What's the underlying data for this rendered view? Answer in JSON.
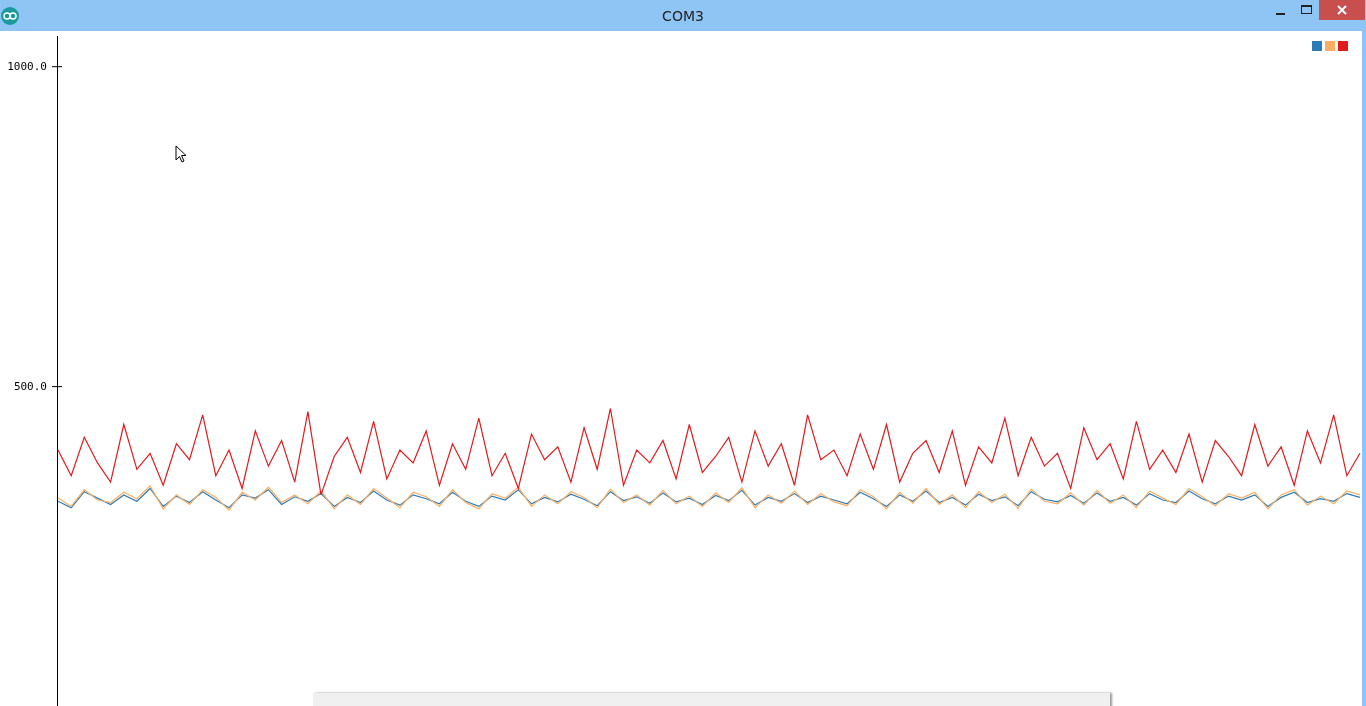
{
  "window": {
    "title": "COM3"
  },
  "plot": {
    "chart_data": {
      "type": "line",
      "ylim": [
        0,
        1055
      ],
      "yticks": [
        {
          "value": 1000,
          "label": "1000.0"
        },
        {
          "value": 500,
          "label": "500.0"
        }
      ],
      "series": [
        {
          "color": "#2b7bb9",
          "values": [
            320,
            310,
            335,
            325,
            315,
            330,
            320,
            340,
            312,
            328,
            318,
            335,
            322,
            310,
            330,
            325,
            338,
            315,
            327,
            320,
            332,
            312,
            326,
            318,
            336,
            322,
            314,
            330,
            324,
            316,
            334,
            320,
            312,
            328,
            322,
            338,
            316,
            326,
            319,
            331,
            323,
            313,
            335,
            321,
            327,
            317,
            333,
            319,
            325,
            315,
            329,
            321,
            337,
            314,
            326,
            320,
            332,
            318,
            328,
            322,
            316,
            334,
            324,
            312,
            330,
            320,
            336,
            318,
            326,
            314,
            331,
            321,
            327,
            313,
            335,
            323,
            319,
            329,
            317,
            333,
            320,
            326,
            314,
            332,
            322,
            318,
            336,
            324,
            316,
            328,
            322,
            330,
            312,
            326,
            334,
            318,
            324,
            320,
            332,
            326
          ]
        },
        {
          "color": "#fdae61",
          "values": [
            325,
            312,
            338,
            322,
            318,
            334,
            324,
            344,
            308,
            330,
            315,
            338,
            326,
            306,
            334,
            322,
            342,
            318,
            330,
            316,
            336,
            308,
            330,
            315,
            340,
            325,
            310,
            334,
            327,
            312,
            338,
            318,
            308,
            332,
            325,
            342,
            312,
            330,
            316,
            335,
            326,
            310,
            339,
            318,
            330,
            314,
            337,
            316,
            328,
            312,
            333,
            318,
            341,
            310,
            330,
            317,
            336,
            315,
            332,
            319,
            313,
            338,
            327,
            308,
            334,
            317,
            340,
            315,
            330,
            310,
            335,
            318,
            331,
            309,
            339,
            320,
            316,
            333,
            314,
            337,
            317,
            330,
            310,
            336,
            325,
            315,
            340,
            327,
            313,
            332,
            325,
            334,
            308,
            330,
            338,
            314,
            328,
            316,
            336,
            330
          ]
        },
        {
          "color": "#e31a1c",
          "values": [
            400,
            360,
            420,
            380,
            350,
            440,
            370,
            395,
            345,
            410,
            385,
            455,
            360,
            400,
            340,
            430,
            375,
            415,
            350,
            460,
            330,
            390,
            420,
            365,
            445,
            355,
            400,
            380,
            430,
            345,
            410,
            370,
            450,
            360,
            395,
            340,
            425,
            385,
            405,
            350,
            435,
            370,
            465,
            345,
            400,
            380,
            415,
            355,
            440,
            365,
            390,
            420,
            350,
            430,
            375,
            410,
            345,
            455,
            385,
            400,
            360,
            425,
            370,
            440,
            350,
            395,
            415,
            365,
            430,
            345,
            405,
            380,
            450,
            360,
            420,
            375,
            395,
            340,
            435,
            385,
            410,
            355,
            445,
            370,
            400,
            365,
            425,
            350,
            415,
            390,
            360,
            440,
            375,
            405,
            345,
            430,
            380,
            455,
            360,
            395
          ]
        }
      ]
    }
  }
}
